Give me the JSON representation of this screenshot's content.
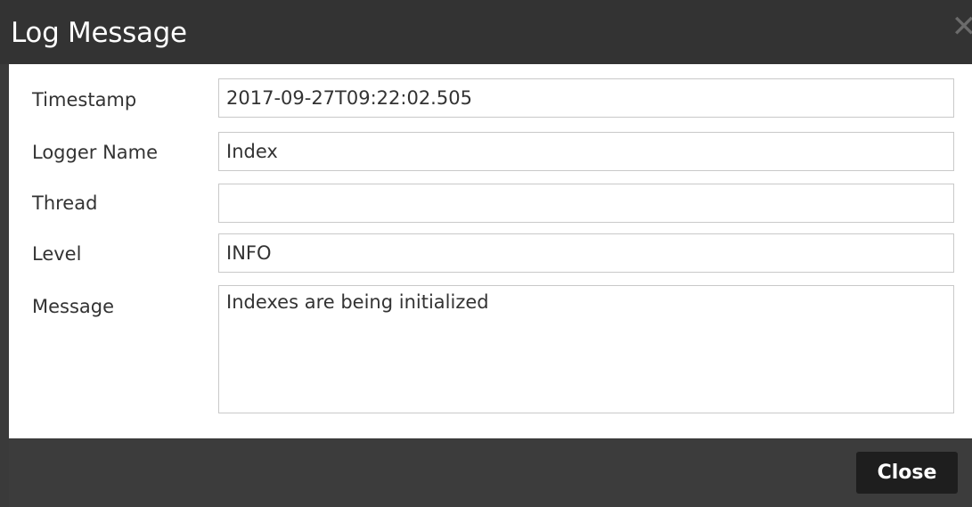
{
  "dialog": {
    "title": "Log Message",
    "close_icon_glyph": "✕"
  },
  "fields": {
    "timestamp": {
      "label": "Timestamp",
      "value": "2017-09-27T09:22:02.505"
    },
    "logger_name": {
      "label": "Logger Name",
      "value": "Index"
    },
    "thread": {
      "label": "Thread",
      "value": ""
    },
    "level": {
      "label": "Level",
      "value": "INFO"
    },
    "message": {
      "label": "Message",
      "value": "Indexes are being initialized"
    }
  },
  "footer": {
    "close_label": "Close"
  },
  "colors": {
    "titlebar": "#333333",
    "footer": "#3c3c3c",
    "close_button": "#1e1e1e",
    "field_border": "#c9c9c9"
  }
}
